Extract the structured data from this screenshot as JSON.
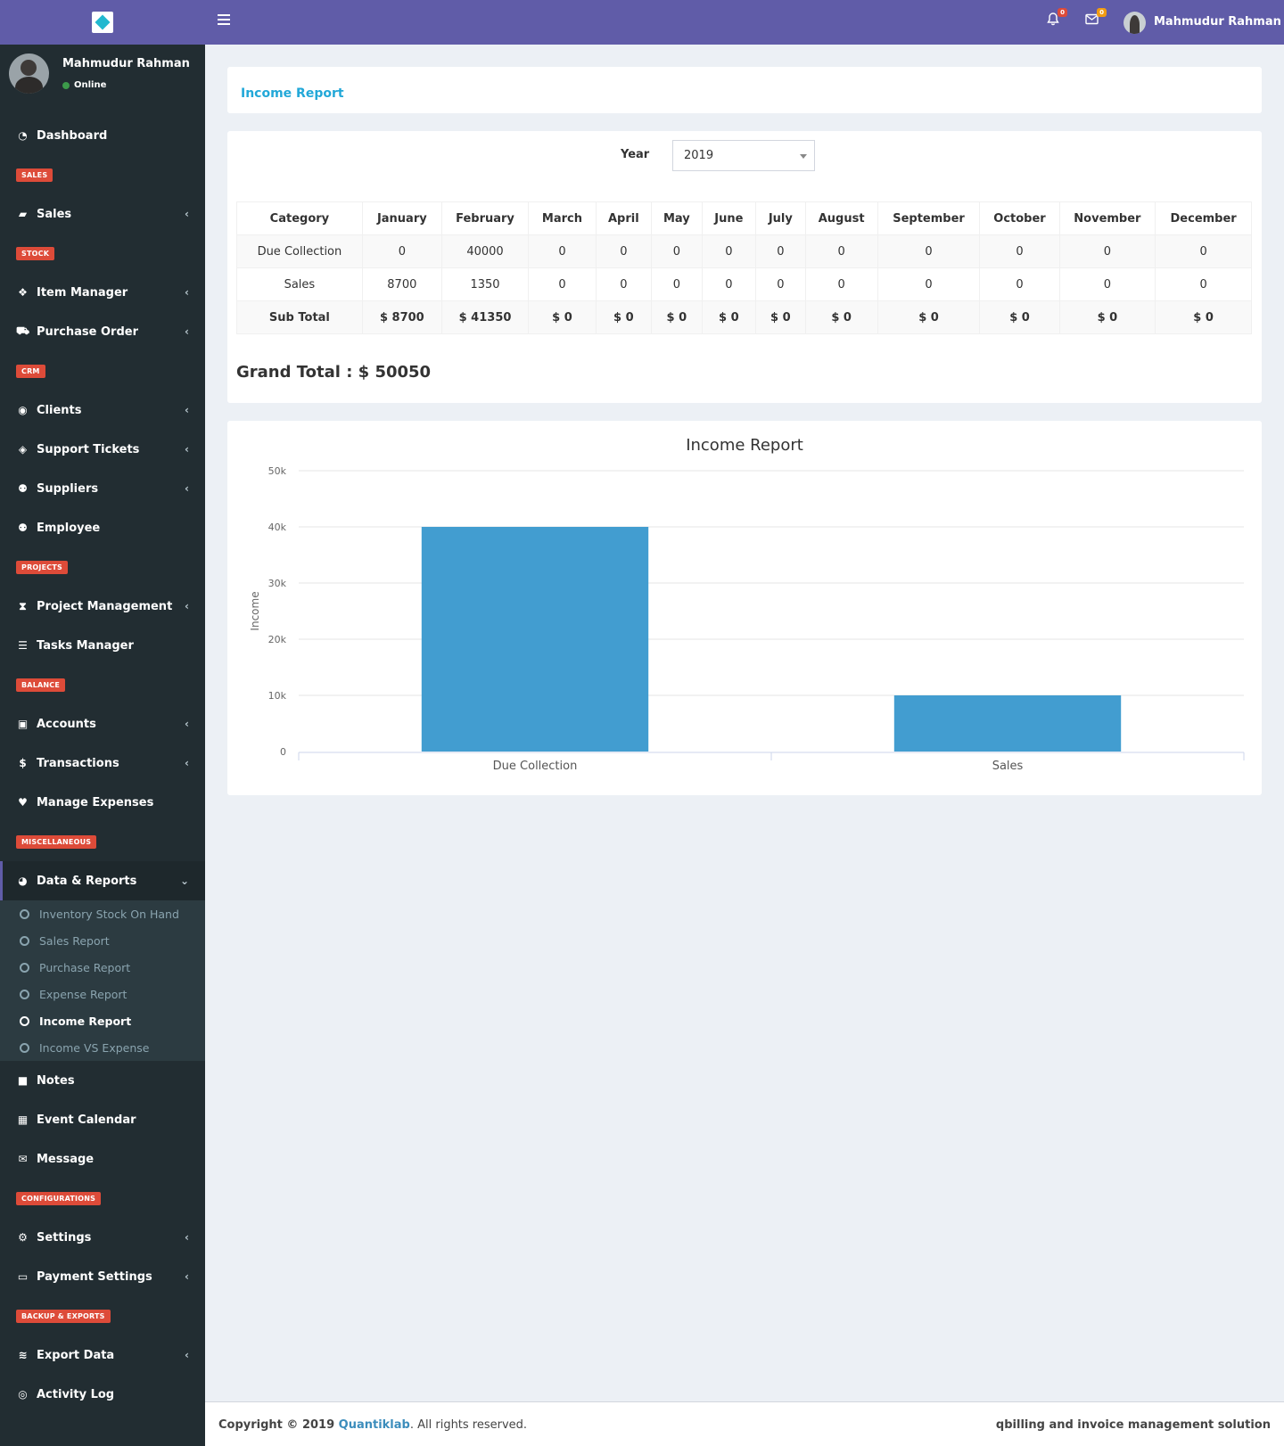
{
  "brand": {
    "logo_icon": "cube-logo-icon"
  },
  "user": {
    "name": "Mahmudur Rahman",
    "status": "Online"
  },
  "sidebar": {
    "items": [
      {
        "type": "item",
        "icon": "dashboard-icon",
        "glyph": "◔",
        "label": "Dashboard",
        "chevron": false
      },
      {
        "type": "header",
        "label": "SALES"
      },
      {
        "type": "item",
        "icon": "book-icon",
        "glyph": "▰",
        "label": "Sales",
        "chevron": true
      },
      {
        "type": "header",
        "label": "STOCK"
      },
      {
        "type": "item",
        "icon": "cubes-icon",
        "glyph": "❖",
        "label": "Item Manager",
        "chevron": true
      },
      {
        "type": "item",
        "icon": "cart-icon",
        "glyph": "⛟",
        "label": "Purchase Order",
        "chevron": true
      },
      {
        "type": "header",
        "label": "CRM"
      },
      {
        "type": "item",
        "icon": "user-circle-icon",
        "glyph": "◉",
        "label": "Clients",
        "chevron": true
      },
      {
        "type": "item",
        "icon": "ticket-icon",
        "glyph": "◈",
        "label": "Support Tickets",
        "chevron": true
      },
      {
        "type": "item",
        "icon": "users-icon",
        "glyph": "⚉",
        "label": "Suppliers",
        "chevron": true
      },
      {
        "type": "item",
        "icon": "users-icon",
        "glyph": "⚉",
        "label": "Employee",
        "chevron": false
      },
      {
        "type": "header",
        "label": "PROJECTS"
      },
      {
        "type": "item",
        "icon": "hourglass-icon",
        "glyph": "⧗",
        "label": "Project Management",
        "chevron": true
      },
      {
        "type": "item",
        "icon": "tasks-icon",
        "glyph": "☰",
        "label": "Tasks Manager",
        "chevron": false
      },
      {
        "type": "header",
        "label": "BALANCE"
      },
      {
        "type": "item",
        "icon": "money-icon",
        "glyph": "▣",
        "label": "Accounts",
        "chevron": true
      },
      {
        "type": "item",
        "icon": "dollar-icon",
        "glyph": "$",
        "label": "Transactions",
        "chevron": true
      },
      {
        "type": "item",
        "icon": "heartbeat-icon",
        "glyph": "♥",
        "label": "Manage Expenses",
        "chevron": false
      },
      {
        "type": "header",
        "label": "MISCELLANEOUS"
      },
      {
        "type": "item",
        "icon": "pie-chart-icon",
        "glyph": "◕",
        "label": "Data & Reports",
        "chevron": true,
        "active": true,
        "sub": [
          {
            "label": "Inventory Stock On Hand"
          },
          {
            "label": "Sales Report"
          },
          {
            "label": "Purchase Report"
          },
          {
            "label": "Expense Report"
          },
          {
            "label": "Income Report",
            "current": true
          },
          {
            "label": "Income VS Expense"
          }
        ]
      },
      {
        "type": "item",
        "icon": "sticky-note-icon",
        "glyph": "■",
        "label": "Notes",
        "chevron": false
      },
      {
        "type": "item",
        "icon": "calendar-icon",
        "glyph": "▦",
        "label": "Event Calendar",
        "chevron": false
      },
      {
        "type": "item",
        "icon": "envelope-icon",
        "glyph": "✉",
        "label": "Message",
        "chevron": false
      },
      {
        "type": "header",
        "label": "CONFIGURATIONS"
      },
      {
        "type": "item",
        "icon": "cogs-icon",
        "glyph": "⚙",
        "label": "Settings",
        "chevron": true
      },
      {
        "type": "item",
        "icon": "credit-card-icon",
        "glyph": "▭",
        "label": "Payment Settings",
        "chevron": true
      },
      {
        "type": "header",
        "label": "BACKUP & EXPORTS"
      },
      {
        "type": "item",
        "icon": "database-icon",
        "glyph": "≋",
        "label": "Export Data",
        "chevron": true
      },
      {
        "type": "item",
        "icon": "eye-icon",
        "glyph": "◎",
        "label": "Activity Log",
        "chevron": false
      }
    ]
  },
  "topbar": {
    "notifications_count": "0",
    "messages_count": "0",
    "notif_color": "#dd4b39",
    "msg_color": "#f39c12",
    "user_name": "Mahmudur Rahman"
  },
  "page": {
    "title": "Income Report"
  },
  "filter": {
    "year_label": "Year",
    "year_value": "2019"
  },
  "table": {
    "headers": [
      "Category",
      "January",
      "February",
      "March",
      "April",
      "May",
      "June",
      "July",
      "August",
      "September",
      "October",
      "November",
      "December"
    ],
    "rows": [
      [
        "Due Collection",
        "0",
        "40000",
        "0",
        "0",
        "0",
        "0",
        "0",
        "0",
        "0",
        "0",
        "0",
        "0"
      ],
      [
        "Sales",
        "8700",
        "1350",
        "0",
        "0",
        "0",
        "0",
        "0",
        "0",
        "0",
        "0",
        "0",
        "0"
      ],
      [
        "Sub Total",
        "$ 8700",
        "$ 41350",
        "$ 0",
        "$ 0",
        "$ 0",
        "$ 0",
        "$ 0",
        "$ 0",
        "$ 0",
        "$ 0",
        "$ 0",
        "$ 0"
      ]
    ]
  },
  "grand_total": "Grand Total : $ 50050",
  "chart_data": {
    "type": "bar",
    "title": "Income Report",
    "ylabel": "Income",
    "xlabel": "",
    "categories": [
      "Due Collection",
      "Sales"
    ],
    "values": [
      40000,
      10000
    ],
    "ylim": [
      0,
      50000
    ],
    "yticks": [
      0,
      10000,
      20000,
      30000,
      40000,
      50000
    ],
    "ytick_labels": [
      "0",
      "10k",
      "20k",
      "30k",
      "40k",
      "50k"
    ],
    "bar_color": "#429dd0",
    "grid": true
  },
  "footer": {
    "copyright_prefix": "Copyright © 2019 ",
    "company": "Quantiklab",
    "copyright_suffix": ". All rights reserved.",
    "right": "qbilling and invoice management solution"
  }
}
